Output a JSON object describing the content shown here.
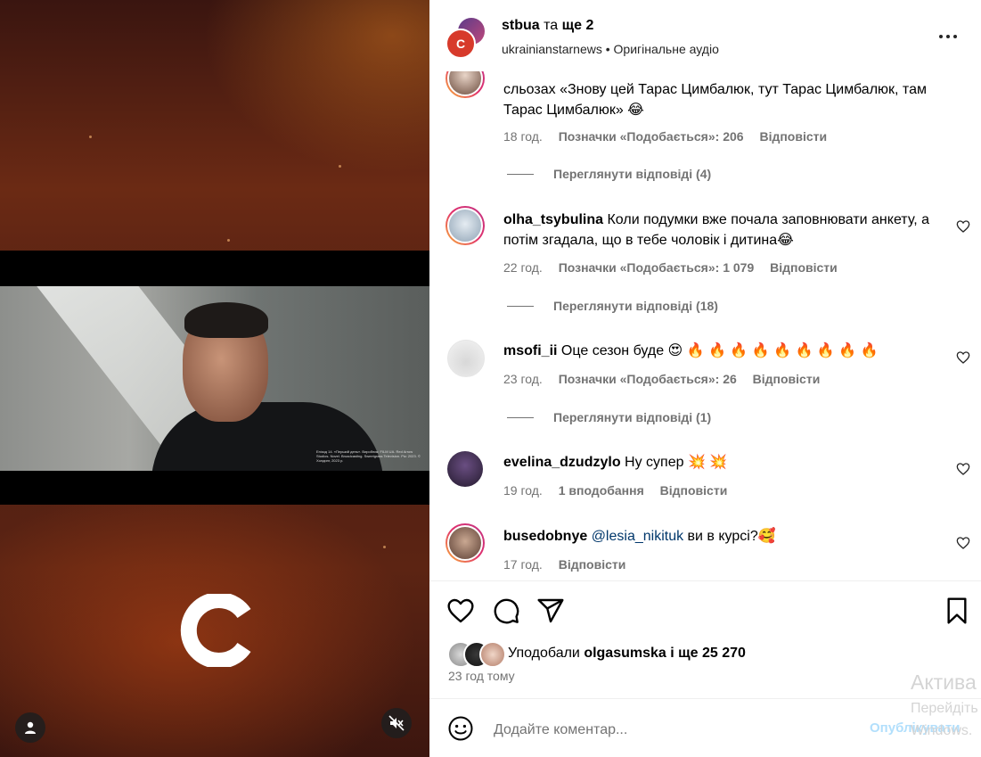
{
  "header": {
    "author": "stbua",
    "joiner": "та",
    "coauthors": "ще 2",
    "account": "ukrainianstarnews",
    "separator": "•",
    "audio": "Оригінальне аудіо"
  },
  "comments": [
    {
      "text": "сльозах «Знову цей Тарас Цимбалюк, тут Тарас Цимбалюк, там Тарас Цимбалюк» 😂",
      "time": "18 год.",
      "likes": "Позначки «Подобається»: 206",
      "reply": "Відповісти",
      "view_replies": "Переглянути відповіді (4)"
    },
    {
      "user": "olha_tsybulina",
      "text": "Коли подумки вже почала заповнювати анкету, а потім згадала, що в тебе чоловік і дитина😂",
      "time": "22 год.",
      "likes": "Позначки «Подобається»: 1 079",
      "reply": "Відповісти",
      "view_replies": "Переглянути відповіді (18)"
    },
    {
      "user": "msofi_ii",
      "text": "Оце сезон буде 😍 🔥 🔥 🔥 🔥 🔥 🔥 🔥 🔥 🔥",
      "time": "23 год.",
      "likes": "Позначки «Подобається»: 26",
      "reply": "Відповісти",
      "view_replies": "Переглянути відповіді (1)"
    },
    {
      "user": "evelina_dzudzylo",
      "text": "Ну супер 💥 💥",
      "time": "19 год.",
      "likes": "1 вподобання",
      "reply": "Відповісти"
    },
    {
      "user": "busedobnye",
      "mention": "@lesia_nikituk",
      "text": "ви в курсі?🥰",
      "time": "17 год.",
      "reply": "Відповісти"
    }
  ],
  "likes": {
    "prefix": "Уподобали",
    "user": "olgasumska",
    "rest": "і ще 25 270"
  },
  "time_ago": "23 год тому",
  "compose": {
    "placeholder": "Додайте коментар...",
    "publish": "Опублікувати"
  },
  "watermark": {
    "line1": "Актива",
    "line2": "Перейдіть",
    "line3": "Windows."
  },
  "video_credits": "Епізод 14. «Перший день». Виробник: FILM UA. Red Arrow Studios. Novel. Broadcasting. Sweetgrass Television. Рік: 2023. © Холдинг, 2023 р.",
  "colors": {
    "accent": "#0095f6",
    "muted": "#737373",
    "mention": "#00376b",
    "brand_red": "#d73a2b"
  }
}
